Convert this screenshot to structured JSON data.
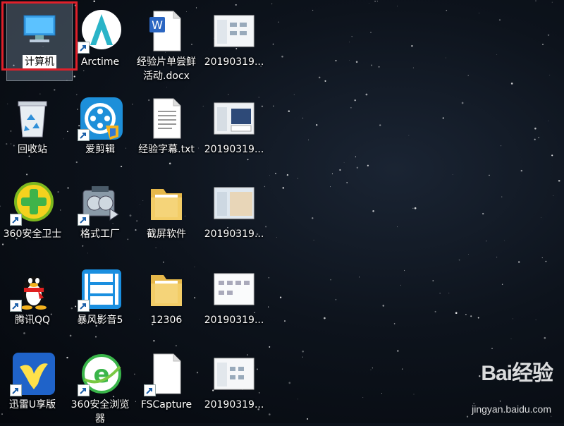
{
  "desktop": {
    "icons": [
      {
        "label": "计算机"
      },
      {
        "label": "Arctime"
      },
      {
        "label": "经验片单尝鲜活动.docx"
      },
      {
        "label": "20190319..."
      },
      {
        "label": "回收站"
      },
      {
        "label": "爱剪辑"
      },
      {
        "label": "经验字幕.txt"
      },
      {
        "label": "20190319..."
      },
      {
        "label": "360安全卫士"
      },
      {
        "label": "格式工厂"
      },
      {
        "label": "截屏软件"
      },
      {
        "label": "20190319..."
      },
      {
        "label": "腾讯QQ"
      },
      {
        "label": "暴风影音5"
      },
      {
        "label": "12306"
      },
      {
        "label": "20190319..."
      },
      {
        "label": "迅雷U享版"
      },
      {
        "label": "360安全浏览器"
      },
      {
        "label": "FSCapture"
      },
      {
        "label": "20190319..."
      }
    ]
  },
  "watermark": {
    "logo": "Bai经验",
    "url": "jingyan.baidu.com"
  }
}
